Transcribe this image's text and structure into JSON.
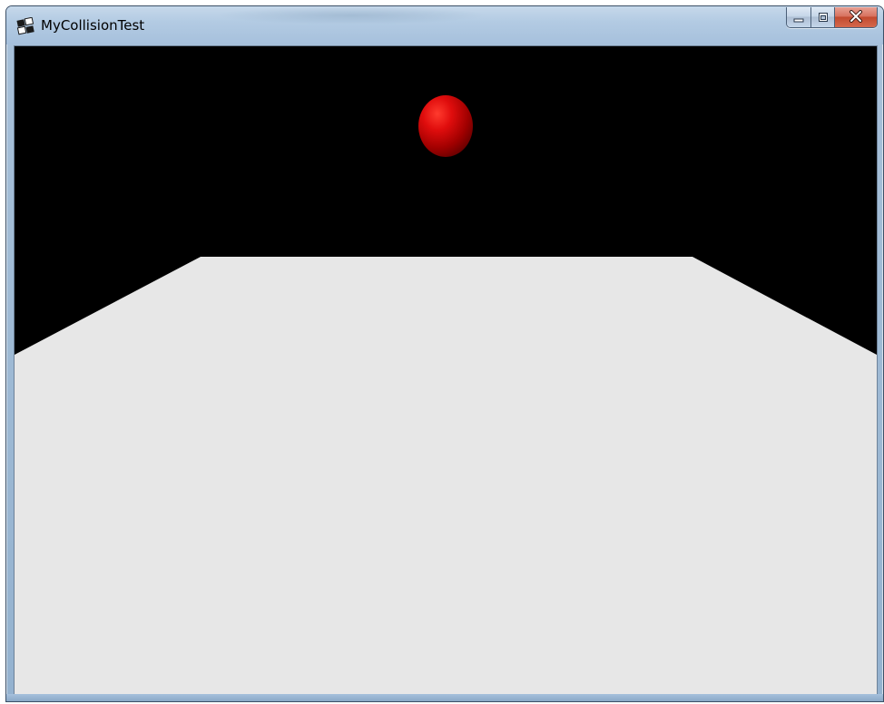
{
  "window": {
    "title": "MyCollisionTest",
    "buttons": {
      "minimize": "minimize-icon",
      "maximize": "maximize-icon",
      "close": "close-icon"
    }
  },
  "scene": {
    "background_color": "#000000",
    "floor_color": "#e7e7e7",
    "ball_color": "#cc0000"
  }
}
